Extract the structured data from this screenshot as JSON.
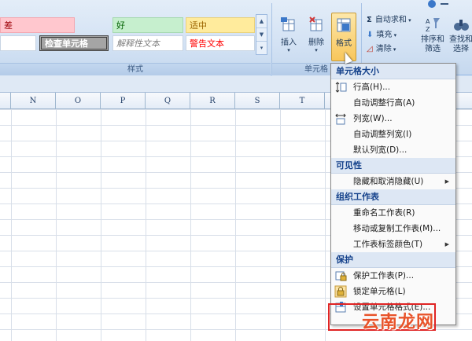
{
  "ribbon": {
    "styles_group_label": "样式",
    "cells_group_label": "单元格",
    "gallery": [
      {
        "label": "差",
        "bg": "#ffc7ce",
        "fg": "#9c0006"
      },
      {
        "label": "好",
        "bg": "#c6efce",
        "fg": "#006100"
      },
      {
        "label": "适中",
        "bg": "#ffeb9c",
        "fg": "#9c6500"
      },
      {
        "label": "检查单元格",
        "bg": "#a5a5a5",
        "fg": "#ffffff"
      },
      {
        "label": "解释性文本",
        "bg": "#ffffff",
        "fg": "#7f7f7f"
      },
      {
        "label": "警告文本",
        "bg": "#ffffff",
        "fg": "#ff0000"
      }
    ],
    "insert_label": "插入",
    "delete_label": "删除",
    "format_label": "格式",
    "autosum_label": "自动求和",
    "fill_label": "填充",
    "clear_label": "清除",
    "sort_label": "排序和\n筛选",
    "find_label": "查找和\n选择"
  },
  "columns": [
    "N",
    "O",
    "P",
    "Q",
    "R",
    "S",
    "T"
  ],
  "menu": {
    "sections": [
      {
        "header": "单元格大小",
        "items": [
          {
            "label": "行高(H)...",
            "icon": "row-height-icon"
          },
          {
            "label": "自动调整行高(A)",
            "icon": ""
          },
          {
            "label": "列宽(W)...",
            "icon": "column-width-icon"
          },
          {
            "label": "自动调整列宽(I)",
            "icon": ""
          },
          {
            "label": "默认列宽(D)...",
            "icon": ""
          }
        ]
      },
      {
        "header": "可见性",
        "items": [
          {
            "label": "隐藏和取消隐藏(U)",
            "icon": "",
            "submenu": true
          }
        ]
      },
      {
        "header": "组织工作表",
        "items": [
          {
            "label": "重命名工作表(R)",
            "icon": ""
          },
          {
            "label": "移动或复制工作表(M)...",
            "icon": ""
          },
          {
            "label": "工作表标签颜色(T)",
            "icon": "",
            "submenu": true
          }
        ]
      },
      {
        "header": "保护",
        "items": [
          {
            "label": "保护工作表(P)...",
            "icon": "protect-sheet-icon"
          },
          {
            "label": "锁定单元格(L)",
            "icon": "lock-icon"
          },
          {
            "label": "设置单元格格式(E)...",
            "icon": "format-cells-icon"
          }
        ]
      }
    ]
  },
  "watermark": "云南龙网"
}
